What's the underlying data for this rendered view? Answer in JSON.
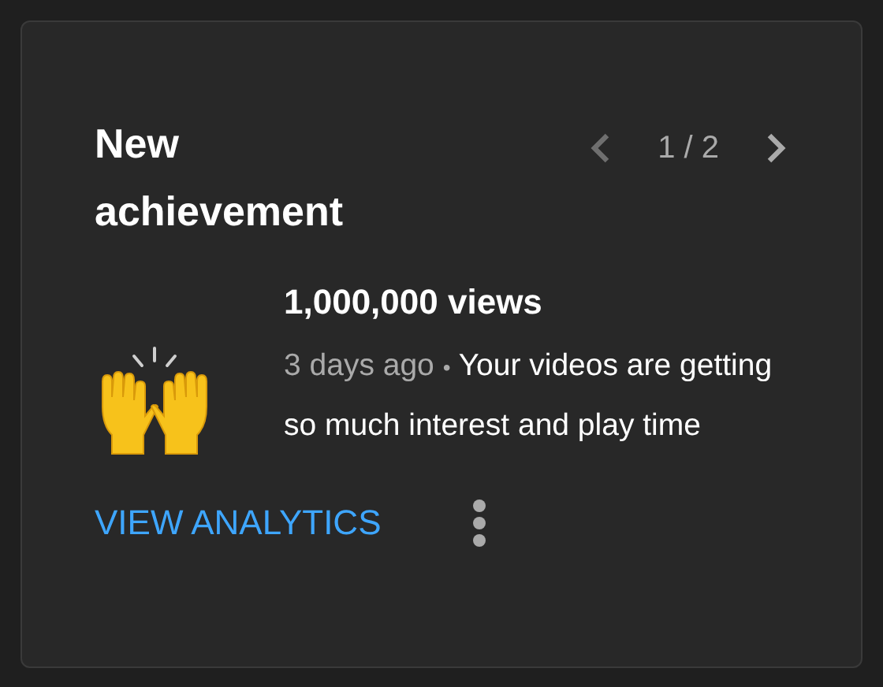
{
  "card": {
    "title": "New achievement",
    "pager": {
      "previous": {
        "disabled": true
      },
      "position": "1 / 2",
      "next": {
        "disabled": false
      }
    },
    "achievement": {
      "title": "1,000,000 views",
      "time": "3 days ago",
      "separator": "•",
      "description": "Your videos are getting so much interest and play time"
    },
    "actions": [
      {
        "kind": "link",
        "label": "VIEW ANALYTICS"
      },
      {
        "kind": "menu"
      }
    ]
  }
}
